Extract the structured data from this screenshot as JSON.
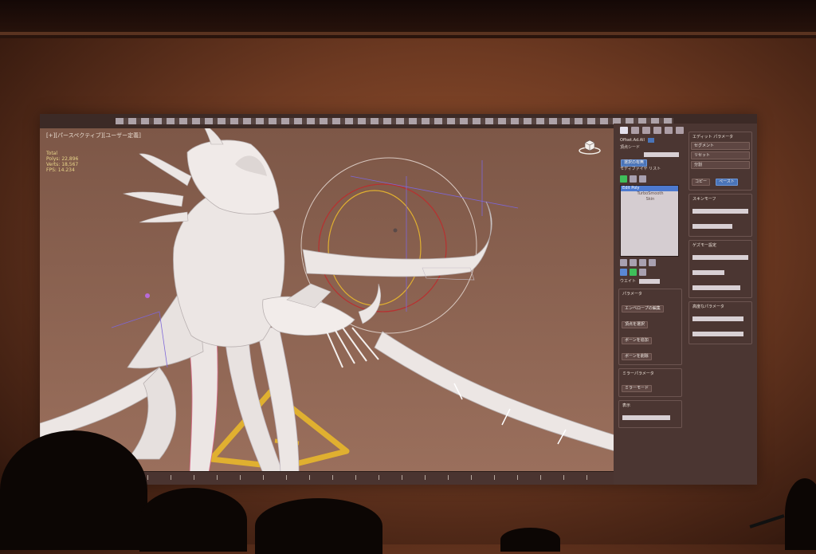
{
  "app": {
    "viewport_label": "[+][パースペクティブ][ユーザー定義]",
    "stats": [
      "Total",
      "Polys: 22,896",
      "Verts: 18,567",
      "FPS: 14.234"
    ]
  },
  "panel": {
    "object_name": "Offset.Ad.All",
    "color_label": "頂点シード",
    "selection_label": "選択の有無",
    "modifier_list_label": "モディファイヤ リスト",
    "modifier_items": [
      "Edit Poly",
      "TurboSmooth",
      "Skin"
    ],
    "weight_label": "ウエイト",
    "rollouts": [
      {
        "title": "パラメータ",
        "buttons": [
          "エンベロープの編集",
          "頂点を選択",
          "ボーンを追加",
          "ボーンを削除"
        ]
      },
      {
        "title": "ミラーパラメータ",
        "buttons": [
          "ミラーモード"
        ]
      },
      {
        "title": "表示"
      }
    ],
    "side_title": "エディット パラメータ",
    "side_buttons": [
      "セグメント",
      "リセット",
      "分割",
      "コピー",
      "ペースト"
    ],
    "side_sections": [
      "スキンモーフ",
      "ゲズモー設定",
      "高度なパラメータ"
    ]
  },
  "colors": {
    "accent": "#4a74b8",
    "selected": "#4d7ad0",
    "model": "#ece6e4",
    "rig_yellow": "#e0b030",
    "rig_purple": "#7d66d8",
    "rig_red": "#b83030"
  }
}
